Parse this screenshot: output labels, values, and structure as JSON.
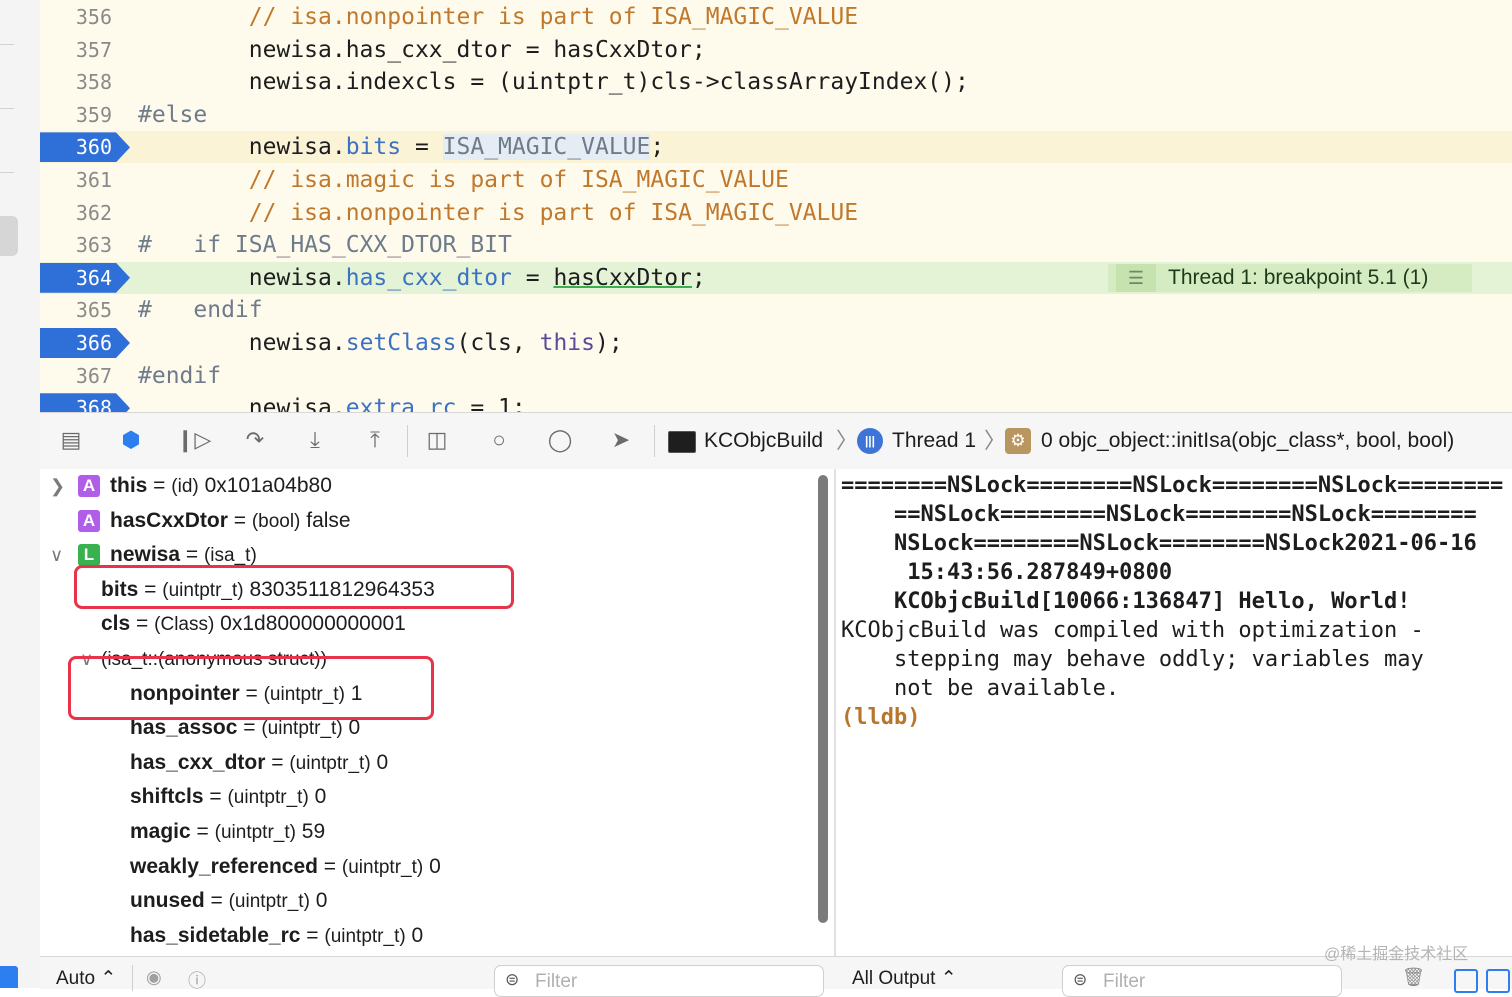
{
  "editor": {
    "lines": [
      {
        "num": "356",
        "segments": [
          {
            "t": "        ",
            "c": ""
          },
          {
            "t": "// isa.nonpointer is part of ISA_MAGIC_VALUE",
            "c": "c-com"
          }
        ]
      },
      {
        "num": "357",
        "segments": [
          {
            "t": "        newisa.has_cxx_dtor = hasCxxDtor;",
            "c": ""
          }
        ]
      },
      {
        "num": "358",
        "segments": [
          {
            "t": "        newisa.indexcls = (uintptr_t)cls->classArrayIndex();",
            "c": ""
          }
        ]
      },
      {
        "num": "359",
        "segments": [
          {
            "t": "#else",
            "c": "c-pre"
          }
        ]
      },
      {
        "num": "360",
        "breakpoint": true,
        "highlight": true,
        "segments": [
          {
            "t": "        newisa.",
            "c": ""
          },
          {
            "t": "bits",
            "c": "c-mem"
          },
          {
            "t": " = ",
            "c": ""
          },
          {
            "t": "ISA_MAGIC_VALUE",
            "c": "c-mac"
          },
          {
            "t": ";",
            "c": ""
          }
        ]
      },
      {
        "num": "361",
        "segments": [
          {
            "t": "        ",
            "c": ""
          },
          {
            "t": "// isa.magic is part of ISA_MAGIC_VALUE",
            "c": "c-com"
          }
        ]
      },
      {
        "num": "362",
        "segments": [
          {
            "t": "        ",
            "c": ""
          },
          {
            "t": "// isa.nonpointer is part of ISA_MAGIC_VALUE",
            "c": "c-com"
          }
        ]
      },
      {
        "num": "363",
        "segments": [
          {
            "t": "#   if ISA_HAS_CXX_DTOR_BIT",
            "c": "c-pre"
          }
        ]
      },
      {
        "num": "364",
        "breakpoint": true,
        "current": true,
        "segments": [
          {
            "t": "        newisa.",
            "c": ""
          },
          {
            "t": "has_cxx_dtor",
            "c": "c-mem"
          },
          {
            "t": " = ",
            "c": ""
          },
          {
            "t": "hasCxxDtor",
            "c": "c-ul"
          },
          {
            "t": ";",
            "c": ""
          }
        ]
      },
      {
        "num": "365",
        "segments": [
          {
            "t": "#   endif",
            "c": "c-pre"
          }
        ]
      },
      {
        "num": "366",
        "breakpoint": true,
        "segments": [
          {
            "t": "        newisa.",
            "c": ""
          },
          {
            "t": "setClass",
            "c": "c-mem"
          },
          {
            "t": "(cls, ",
            "c": ""
          },
          {
            "t": "this",
            "c": "c-kw"
          },
          {
            "t": ");",
            "c": ""
          }
        ]
      },
      {
        "num": "367",
        "segments": [
          {
            "t": "#endif",
            "c": "c-pre"
          }
        ]
      },
      {
        "num": "368",
        "breakpoint": true,
        "segments": [
          {
            "t": "        newisa.",
            "c": ""
          },
          {
            "t": "extra_rc",
            "c": "c-mem"
          },
          {
            "t": " = 1;",
            "c": ""
          }
        ]
      }
    ],
    "breakpoint_annotation": "Thread 1: breakpoint 5.1 (1)"
  },
  "toolbar": {
    "target": "KCObjcBuild",
    "thread": "Thread 1",
    "thread_icon": "|||",
    "frame": "0 objc_object::initIsa(objc_class*, bool, bool)"
  },
  "variables": [
    {
      "name": "this",
      "type": "(id)",
      "value": "0x101a04b80",
      "badge": "A",
      "disclosure": "right",
      "indent": 0
    },
    {
      "name": "hasCxxDtor",
      "type": "(bool)",
      "value": "false",
      "badge": "A",
      "indent": 0
    },
    {
      "name": "newisa",
      "type": "(isa_t)",
      "value": "",
      "badge": "L",
      "disclosure": "down",
      "indent": 0
    },
    {
      "name": "bits",
      "type": "(uintptr_t)",
      "value": "8303511812964353",
      "indent": 1
    },
    {
      "name": "cls",
      "type": "(Class)",
      "value": "0x1d800000000001",
      "indent": 1
    },
    {
      "name": "",
      "type": "(isa_t::(anonymous struct))",
      "value": "",
      "disclosure": "down",
      "indent": 1
    },
    {
      "name": "nonpointer",
      "type": "(uintptr_t)",
      "value": "1",
      "indent": 2
    },
    {
      "name": "has_assoc",
      "type": "(uintptr_t)",
      "value": "0",
      "indent": 2
    },
    {
      "name": "has_cxx_dtor",
      "type": "(uintptr_t)",
      "value": "0",
      "indent": 2
    },
    {
      "name": "shiftcls",
      "type": "(uintptr_t)",
      "value": "0",
      "indent": 2
    },
    {
      "name": "magic",
      "type": "(uintptr_t)",
      "value": "59",
      "indent": 2
    },
    {
      "name": "weakly_referenced",
      "type": "(uintptr_t)",
      "value": "0",
      "indent": 2
    },
    {
      "name": "unused",
      "type": "(uintptr_t)",
      "value": "0",
      "indent": 2
    },
    {
      "name": "has_sidetable_rc",
      "type": "(uintptr_t)",
      "value": "0",
      "indent": 2
    }
  ],
  "console": {
    "lines": [
      {
        "t": "========NSLock========NSLock========NSLock========",
        "c": "b"
      },
      {
        "t": "    ==NSLock========NSLock========NSLock========",
        "c": "b"
      },
      {
        "t": "    NSLock========NSLock========NSLock2021-06-16",
        "c": "b"
      },
      {
        "t": "     15:43:56.287849+0800",
        "c": "b"
      },
      {
        "t": "    KCObjcBuild[10066:136847] Hello, World!",
        "c": "b"
      },
      {
        "t": "KCObjcBuild was compiled with optimization -",
        "c": ""
      },
      {
        "t": "    stepping may behave oddly; variables may",
        "c": ""
      },
      {
        "t": "    not be available.",
        "c": ""
      },
      {
        "t": "(lldb)",
        "c": "lldb"
      }
    ]
  },
  "bottom": {
    "auto_label": "Auto ⌃",
    "vars_filter_placeholder": "Filter",
    "output_label": "All Output ⌃",
    "console_filter_placeholder": "Filter",
    "watermark": "@稀土掘金技术社区"
  },
  "colors": {
    "breakpoint": "#2f6fd8",
    "current_line": "#e4f3d6",
    "annotation": "#d5ecc2",
    "highlight_box": "#e8344a",
    "lldb_prompt": "#b7762c"
  }
}
